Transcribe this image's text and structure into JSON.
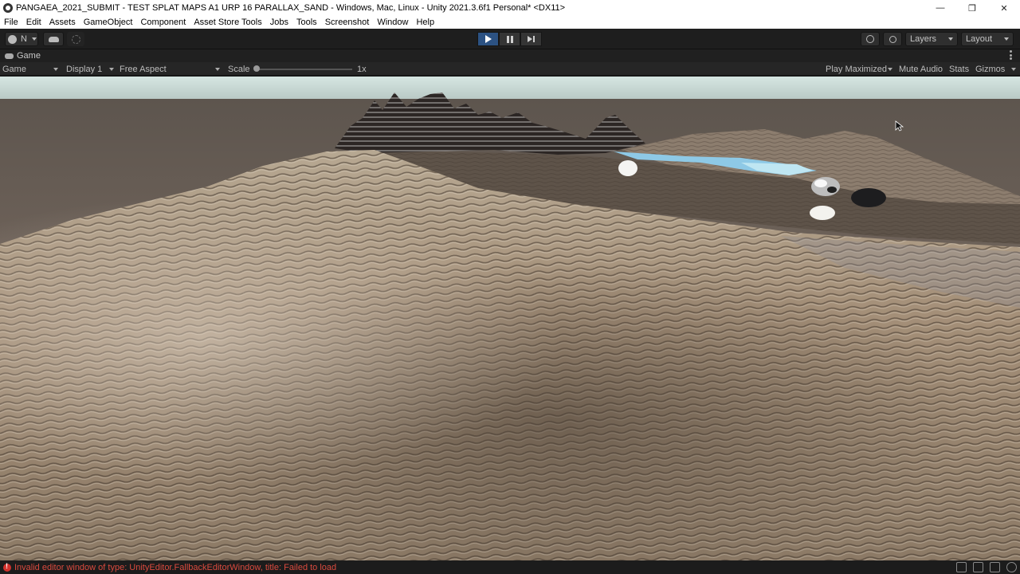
{
  "window": {
    "title": "PANGAEA_2021_SUBMIT - TEST SPLAT MAPS A1 URP 16 PARALLAX_SAND - Windows, Mac, Linux - Unity 2021.3.6f1 Personal* <DX11>",
    "minimize": "—",
    "maximize": "❐",
    "close": "✕"
  },
  "menu": [
    "File",
    "Edit",
    "Assets",
    "GameObject",
    "Component",
    "Asset Store Tools",
    "Jobs",
    "Tools",
    "Screenshot",
    "Window",
    "Help"
  ],
  "toolbar": {
    "account_label": "N",
    "layers_label": "Layers",
    "layout_label": "Layout",
    "play_state": "playing"
  },
  "game_tab": {
    "label": "Game"
  },
  "game_controls": {
    "view_select": "Game",
    "display_select": "Display 1",
    "aspect_select": "Free Aspect",
    "scale_label": "Scale",
    "scale_value": "1x",
    "scale_fraction": 0.0,
    "play_maximized": "Play Maximized",
    "mute_audio": "Mute Audio",
    "stats": "Stats",
    "gizmos": "Gizmos"
  },
  "status": {
    "message": "Invalid editor window of type: UnityEditor.FallbackEditorWindow, title: Failed to load",
    "color": "#d94a3e"
  },
  "colors": {
    "play_active": "#2c5283",
    "sky": "#c9dcd8",
    "sand": "#a08c74",
    "water": "#8ec9e6"
  }
}
